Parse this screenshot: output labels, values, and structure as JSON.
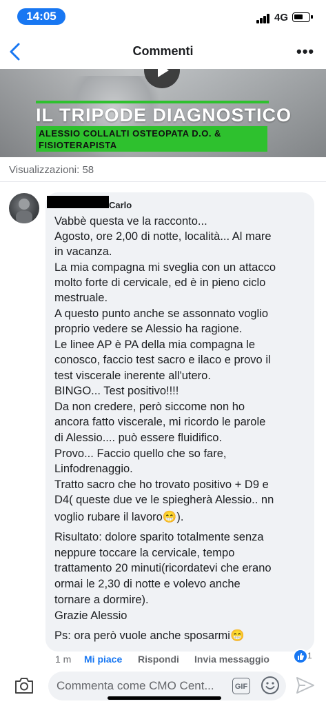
{
  "status_bar": {
    "time": "14:05",
    "network": "4G"
  },
  "nav": {
    "title": "Commenti",
    "back_icon": "chevron-left-icon",
    "more_icon": "more-dots-icon",
    "more_glyph": "•••"
  },
  "video": {
    "title": "IL TRIPODE DIAGNOSTICO",
    "subtitle_line1": "ALESSIO COLLALTI OSTEOPATA D.O. &",
    "subtitle_line2": "FISIOTERAPISTA",
    "accent_color": "#2ec12e"
  },
  "views": {
    "label": "Visualizzazioni: 58"
  },
  "comment": {
    "author": "Carlo",
    "lines": [
      "Vabbè questa ve la racconto...",
      "Agosto, ore 2,00 di notte, località... Al mare",
      "in vacanza.",
      "La mia compagna mi sveglia con un attacco",
      "molto forte di cervicale, ed è in pieno ciclo",
      "mestruale.",
      "A questo punto anche se assonnato voglio",
      "proprio vedere se Alessio ha ragione.",
      "Le linee AP è PA della mia compagna le",
      "conosco, faccio test sacro e ilaco e provo il",
      "test viscerale inerente all'utero.",
      "BINGO... Test positivo!!!!",
      "Da non credere, però siccome non ho",
      "ancora fatto viscerale, mi ricordo le parole",
      "di Alessio.... può essere fluidifico.",
      "Provo... Faccio quello che so fare,",
      "Linfodrenaggio.",
      "Tratto sacro che ho trovato positivo + D9 e",
      "D4( queste due ve le spiegherà Alessio.. nn",
      "voglio rubare il lavoro😁).",
      "Risultato: dolore sparito totalmente senza",
      "neppure toccare la cervicale, tempo",
      "trattamento 20 minuti(ricordatevi che erano",
      "ormai le 2,30 di notte e volevo anche",
      "tornare a dormire).",
      "Grazie Alessio",
      "Ps: ora però vuole anche sposarmi😁"
    ],
    "time": "1 m",
    "like_label": "Mi piace",
    "reply_label": "Rispondi",
    "send_label": "Invia messaggio",
    "like_count": "1"
  },
  "composer": {
    "placeholder": "Commenta come CMO Cent...",
    "gif_label": "GIF",
    "camera_icon": "camera-icon",
    "emoji_icon": "emoji-icon",
    "send_icon": "send-icon"
  },
  "colors": {
    "brand": "#1877f2",
    "bubble": "#f0f2f5",
    "muted": "#65676b"
  }
}
